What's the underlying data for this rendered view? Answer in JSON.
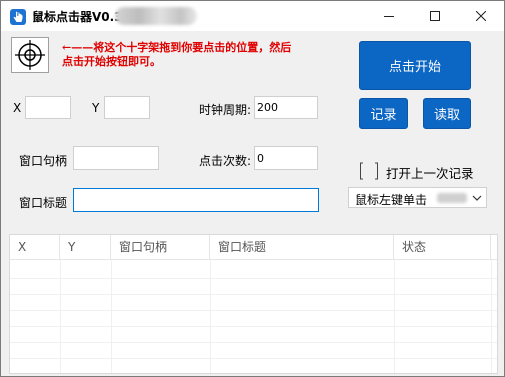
{
  "window": {
    "title": "鼠标点击器V0.3"
  },
  "hint": {
    "text": "←——将这个十字架拖到你要点击的位置，然后点击开始按钮即可。"
  },
  "coords": {
    "x_label": "X",
    "x_value": "",
    "y_label": "Y",
    "y_value": ""
  },
  "clock": {
    "label": "时钟周期:",
    "value": "200"
  },
  "handle": {
    "label": "窗口句柄",
    "value": ""
  },
  "clicks": {
    "label": "点击次数:",
    "value": "0"
  },
  "window_title_field": {
    "label": "窗口标题",
    "value": ""
  },
  "buttons": {
    "start": "点击开始",
    "record": "记录",
    "read": "读取"
  },
  "last_record": {
    "label": "打开上一次记录",
    "checked": false
  },
  "mode_select": {
    "value": "鼠标左键单击"
  },
  "table": {
    "columns": [
      "X",
      "Y",
      "窗口句柄",
      "窗口标题",
      "状态"
    ],
    "rows": []
  },
  "colors": {
    "accent": "#0c66c4",
    "hint": "#e00000",
    "focus": "#0078d7"
  },
  "icons": {
    "app": "hand-cursor-icon",
    "crosshair": "crosshair-icon",
    "dropdown": "chevron-down-icon"
  }
}
